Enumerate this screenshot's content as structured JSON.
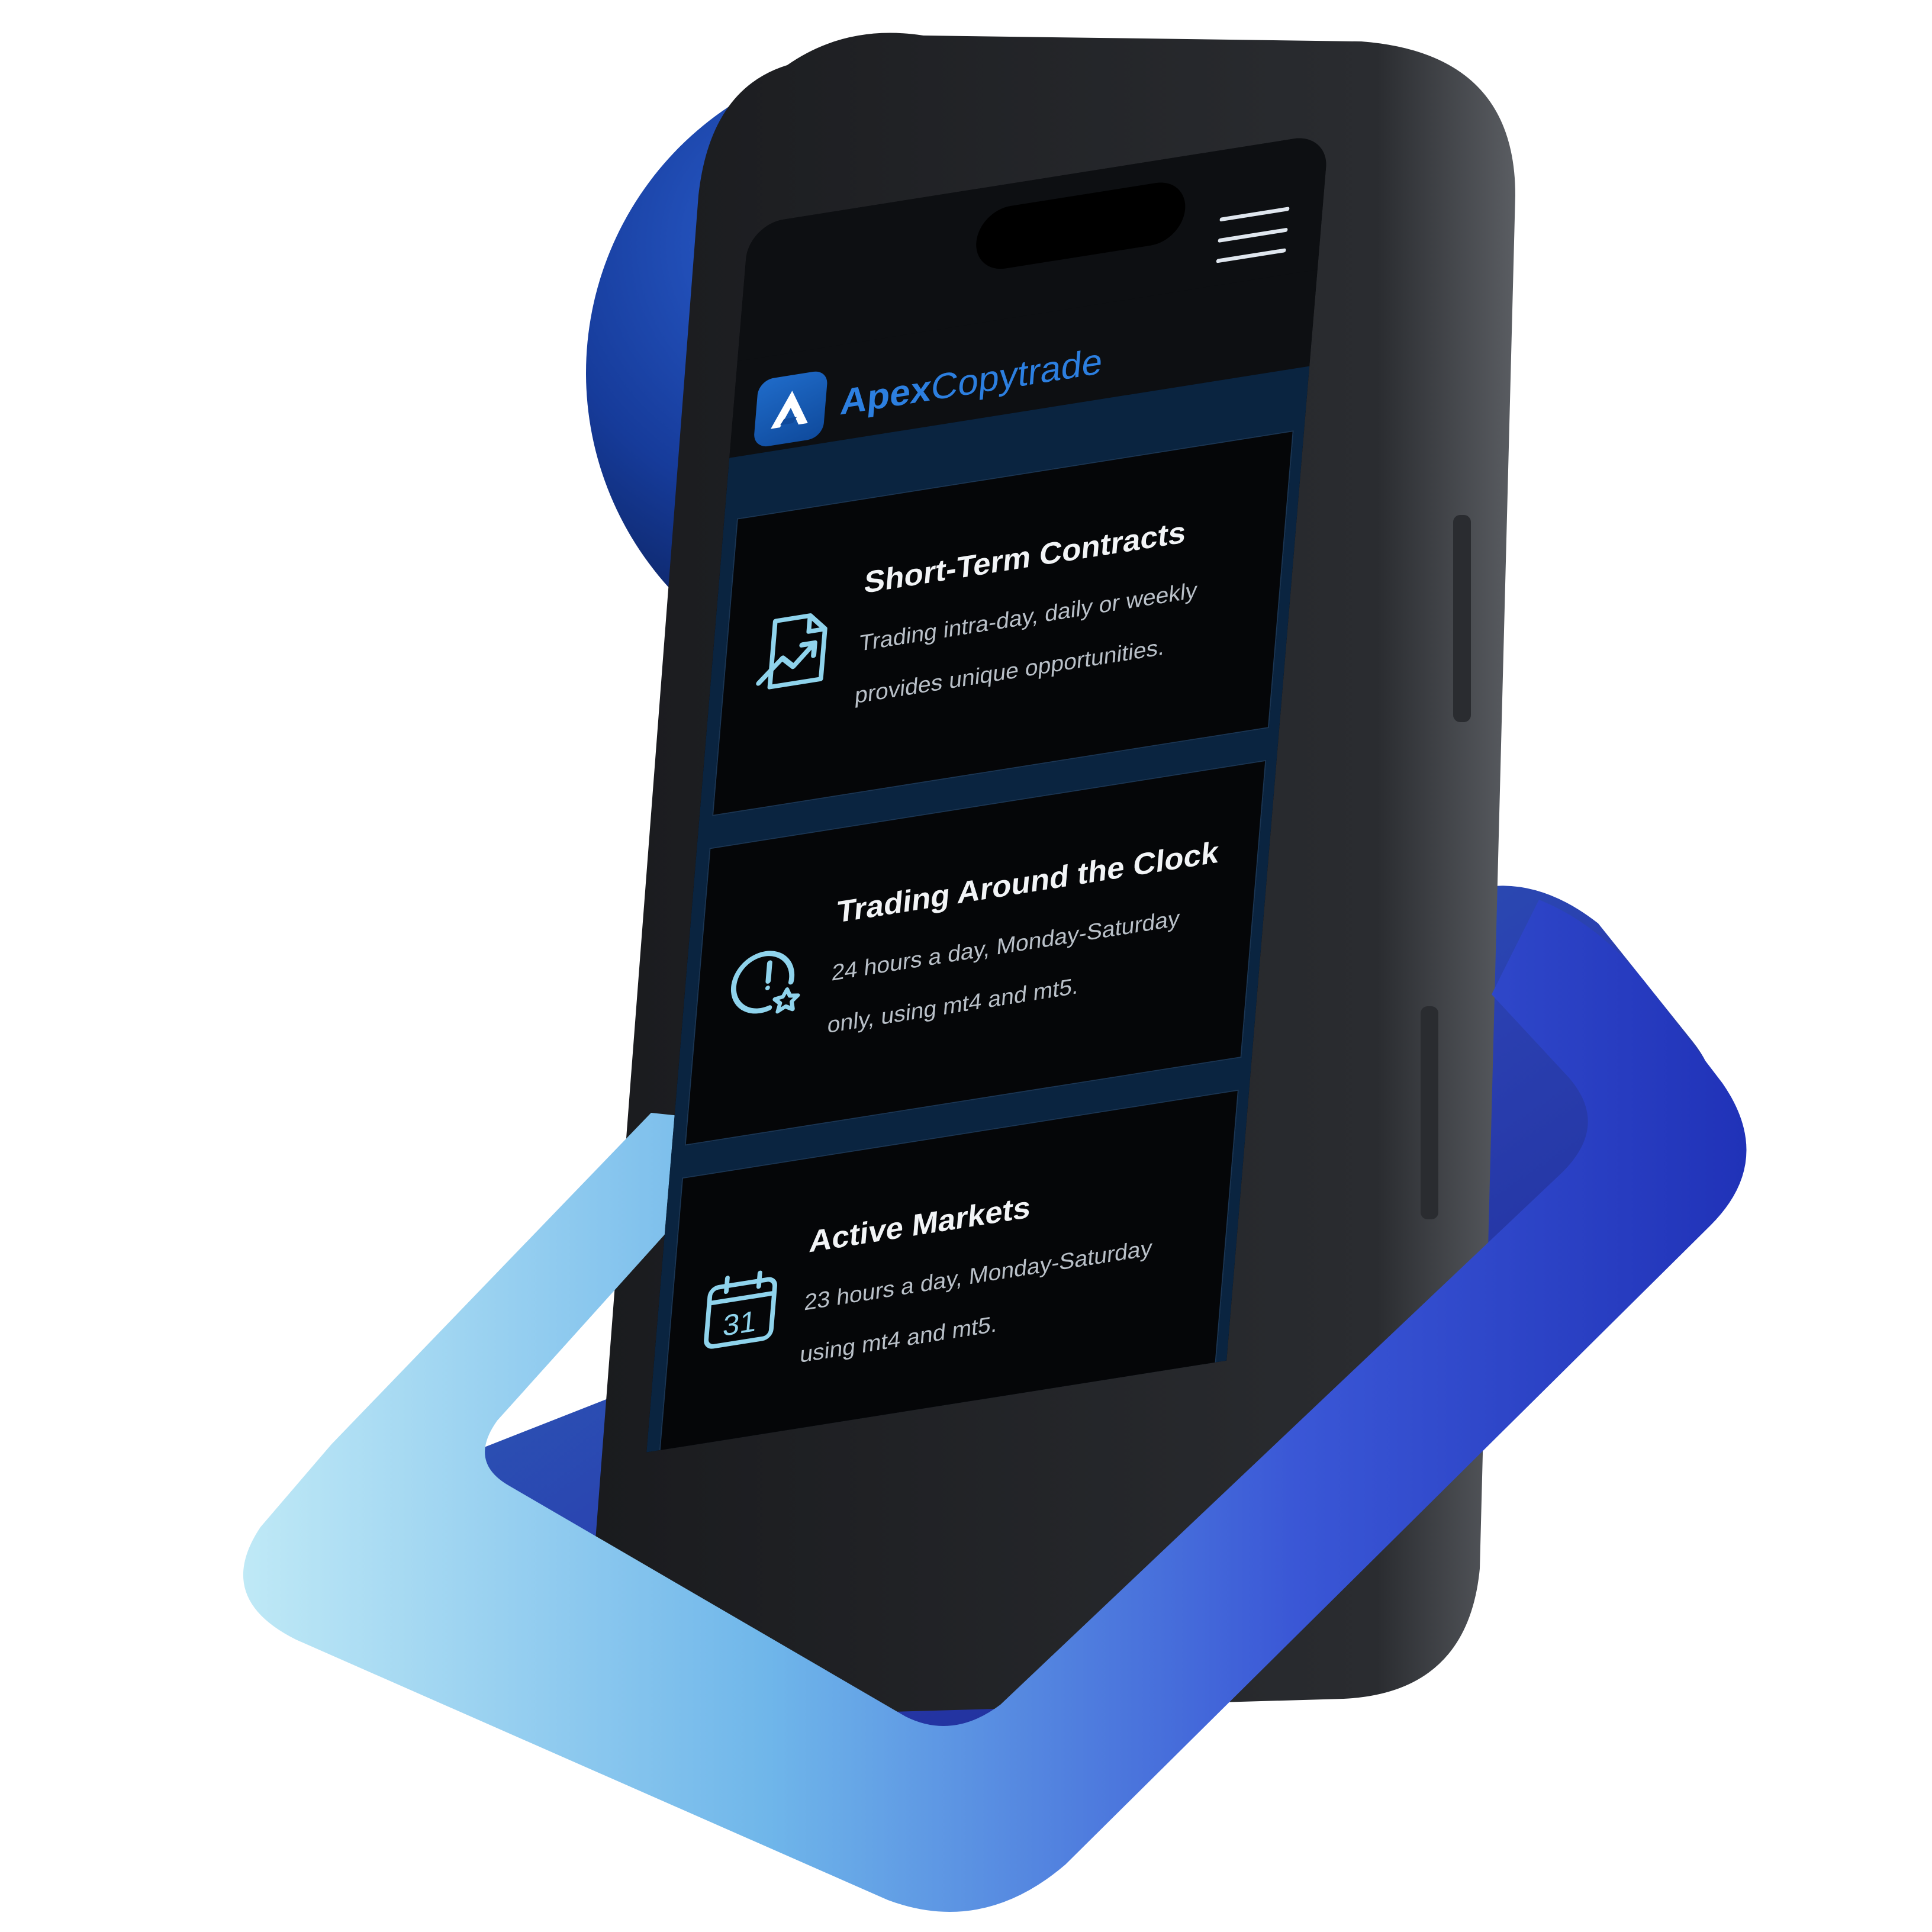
{
  "brand": {
    "name_part1": "Apex",
    "name_part2": "Copytrade"
  },
  "header": {
    "menu_icon": "hamburger-menu-icon"
  },
  "features": [
    {
      "title": "Short-Term Contracts",
      "description": "Trading intra-day, daily or weekly provides unique opportunities.",
      "icon": "chart-document-icon"
    },
    {
      "title": "Trading Around the Clock",
      "description": "24 hours a day, Monday-Saturday only, using mt4 and mt5.",
      "icon": "clock-star-icon"
    },
    {
      "title": "Active Markets",
      "description": "23 hours a day, Monday-Saturday using mt4 and mt5.",
      "icon": "calendar-icon",
      "icon_text": "31"
    }
  ],
  "colors": {
    "accent": "#2c7fe0",
    "icon_cyan": "#8fd3ec",
    "card_bg": "#050608",
    "section_bg": "#0a2440"
  }
}
